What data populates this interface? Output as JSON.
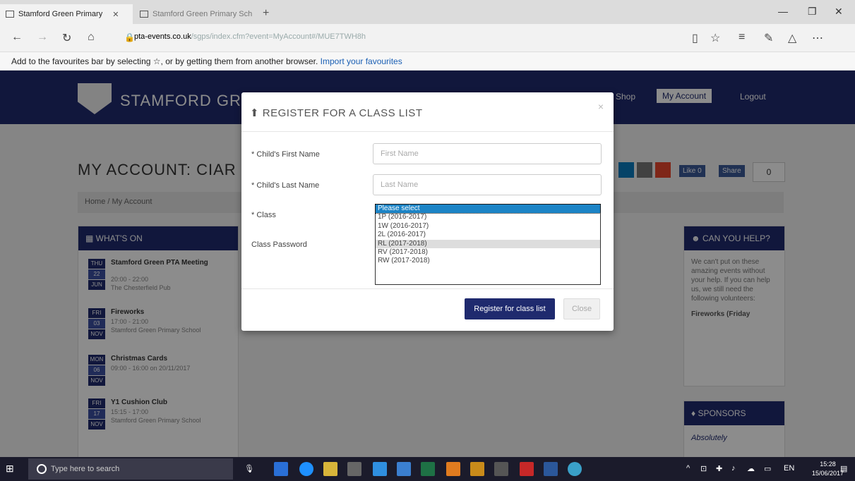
{
  "browser": {
    "tabs": [
      {
        "label": "Stamford Green Primary",
        "active": true
      },
      {
        "label": "Stamford Green Primary Sch",
        "active": false
      }
    ],
    "url_host": "pta-events.co.uk",
    "url_path": "/sgps/index.cfm?event=MyAccount#/MUE7TWH8h",
    "fav_text": "Add to the favourites bar by selecting ☆, or by getting them from another browser.",
    "fav_link": "Import your favourites"
  },
  "site": {
    "title": "STAMFORD GREEN",
    "nav": [
      "Shop",
      "My Account",
      "Logout"
    ],
    "heading": "MY ACCOUNT: CIAR",
    "breadcrumb": "Home / My Account",
    "counter": "0",
    "like": "Like 0",
    "share": "Share"
  },
  "whats_on": {
    "title": "WHAT'S ON",
    "events": [
      {
        "day": "THU",
        "num": "22",
        "month": "JUN",
        "title": "Stamford Green PTA Meeting",
        "time": "20:00 - 22:00",
        "place": "The Chesterfield Pub"
      },
      {
        "day": "FRI",
        "num": "03",
        "month": "NOV",
        "title": "Fireworks",
        "time": "17:00 - 21:00",
        "place": "Stamford Green Primary School"
      },
      {
        "day": "MON",
        "num": "06",
        "month": "NOV",
        "title": "Christmas Cards",
        "time": "09:00 - 16:00 on 20/11/2017",
        "place": ""
      },
      {
        "day": "FRI",
        "num": "17",
        "month": "NOV",
        "title": "Y1 Cushion Club",
        "time": "15:15 - 17:00",
        "place": "Stamford Green Primary School"
      }
    ]
  },
  "help_panel": {
    "title": "CAN YOU HELP?",
    "body": "We can't put on these amazing events without your help. If you can help us, we still need the following volunteers:",
    "item": "Fireworks (Friday"
  },
  "sponsors": {
    "title": "SPONSORS",
    "logo_text": "Absolutely"
  },
  "modal": {
    "title": "REGISTER FOR A CLASS LIST",
    "first_name_label": "* Child's First Name",
    "first_name_placeholder": "First Name",
    "last_name_label": "* Child's Last Name",
    "last_name_placeholder": "Last Name",
    "class_label": "* Class",
    "password_label": "Class Password",
    "class_options": [
      "Please select",
      "1P (2016-2017)",
      "1W (2016-2017)",
      "2L (2016-2017)",
      "RL (2017-2018)",
      "RV (2017-2018)",
      "RW (2017-2018)"
    ],
    "submit_label": "Register for class list",
    "close_label": "Close"
  },
  "taskbar": {
    "search_placeholder": "Type here to search",
    "time": "15:28",
    "date": "15/06/2017"
  }
}
